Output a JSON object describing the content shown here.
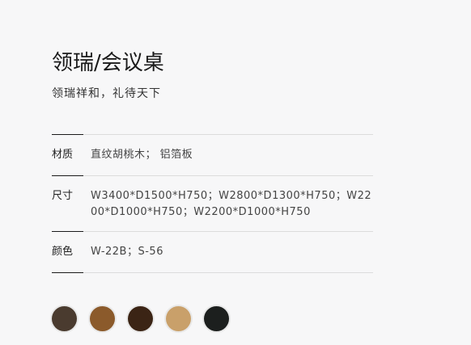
{
  "product": {
    "title": "领瑞/会议桌",
    "slogan": "领瑞祥和，礼待天下"
  },
  "specs": {
    "material": {
      "label": "材质",
      "value": "直纹胡桃木；  铝箔板"
    },
    "size": {
      "label": "尺寸",
      "value": "W3400*D1500*H750；W2800*D1300*H750；W2200*D1000*H750；W2200*D1000*H750"
    },
    "color": {
      "label": "颜色",
      "value": "W-22B；S-56"
    }
  },
  "swatches": [
    {
      "name": "dark-walnut",
      "color": "#4a3b2f"
    },
    {
      "name": "medium-walnut",
      "color": "#8b5a2b"
    },
    {
      "name": "espresso",
      "color": "#3b2415"
    },
    {
      "name": "light-oak",
      "color": "#c9a06a"
    },
    {
      "name": "black",
      "color": "#1c1f1e"
    }
  ]
}
